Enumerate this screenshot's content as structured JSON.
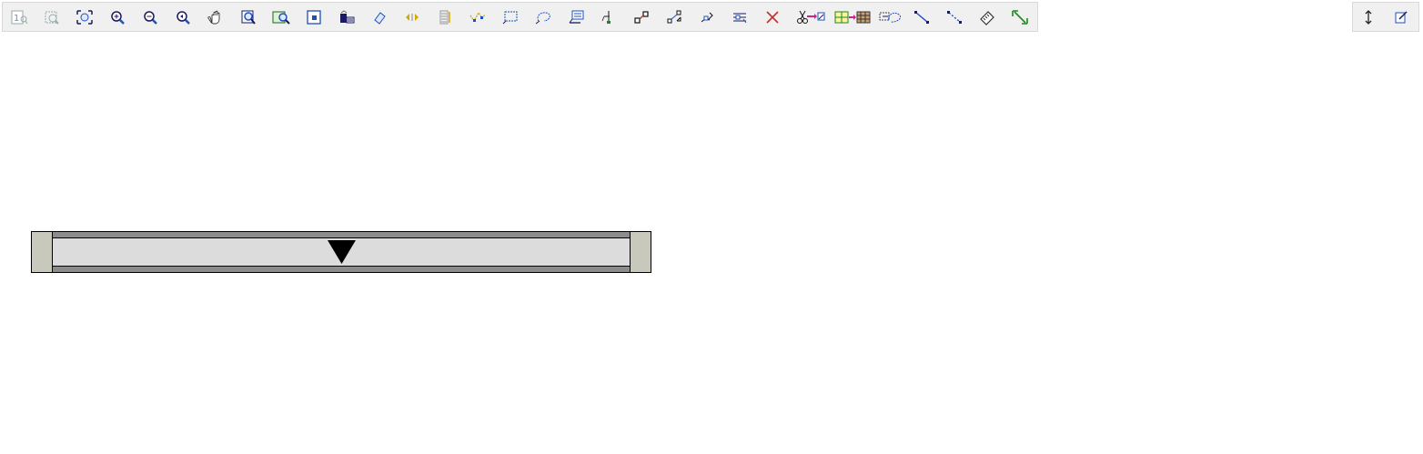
{
  "app": {
    "toolbar": {
      "buttons": [
        {
          "icon": "page-1-icon",
          "tooltip": ""
        },
        {
          "icon": "zoom-page-icon",
          "tooltip": ""
        },
        {
          "icon": "zoom-extents-icon",
          "tooltip": ""
        },
        {
          "icon": "zoom-in-icon",
          "tooltip": ""
        },
        {
          "icon": "zoom-out-icon",
          "tooltip": ""
        },
        {
          "icon": "zoom-previous-icon",
          "tooltip": ""
        },
        {
          "icon": "pan-hand-icon",
          "tooltip": ""
        },
        {
          "icon": "zoom-window-icon",
          "tooltip": ""
        },
        {
          "icon": "zoom-selection-icon",
          "tooltip": ""
        },
        {
          "icon": "select-box-icon",
          "tooltip": ""
        },
        {
          "icon": "layers-icon",
          "tooltip": ""
        },
        {
          "icon": "eraser-icon",
          "tooltip": ""
        },
        {
          "icon": "dimension-arrows-icon",
          "tooltip": ""
        },
        {
          "icon": "text-block-icon",
          "tooltip": ""
        },
        {
          "icon": "polyline-select-icon",
          "tooltip": ""
        },
        {
          "icon": "rectangle-select-icon",
          "tooltip": ""
        },
        {
          "icon": "lasso-select-icon",
          "tooltip": ""
        },
        {
          "icon": "comment-icon",
          "tooltip": ""
        },
        {
          "icon": "hook-point-icon",
          "tooltip": ""
        },
        {
          "icon": "connect-nodes-icon",
          "tooltip": ""
        },
        {
          "icon": "transform-node-icon",
          "tooltip": ""
        },
        {
          "icon": "edit-point-icon",
          "tooltip": ""
        },
        {
          "icon": "align-nodes-icon",
          "tooltip": ""
        },
        {
          "icon": "delete-icon",
          "tooltip": ""
        },
        {
          "icon": "cut-move-icon",
          "tooltip": ""
        },
        {
          "icon": "copy-frame-icon",
          "tooltip": ""
        },
        {
          "icon": "select-region-icon",
          "tooltip": ""
        },
        {
          "icon": "line-tool-icon",
          "tooltip": ""
        },
        {
          "icon": "dotted-line-icon",
          "tooltip": ""
        },
        {
          "icon": "measure-ruler-icon",
          "tooltip": ""
        },
        {
          "icon": "diagonal-dimension-icon",
          "tooltip": ""
        }
      ],
      "right_buttons": [
        {
          "icon": "vertical-resize-icon",
          "tooltip": ""
        },
        {
          "icon": "edit-note-icon",
          "tooltip": ""
        }
      ]
    },
    "colors": {
      "toolbar_bg": "#f0f0f0",
      "icon_blue": "#1f4fbf",
      "icon_dark": "#1a1a5e",
      "icon_gold": "#d4a800",
      "delete_red": "#c0302a",
      "green": "#1a8a1a",
      "magenta": "#d0208a",
      "beam_end": "#c8c8bc",
      "beam_flange": "#8c8c8c",
      "beam_web": "#dcdcdc",
      "marker": "#000000"
    }
  }
}
